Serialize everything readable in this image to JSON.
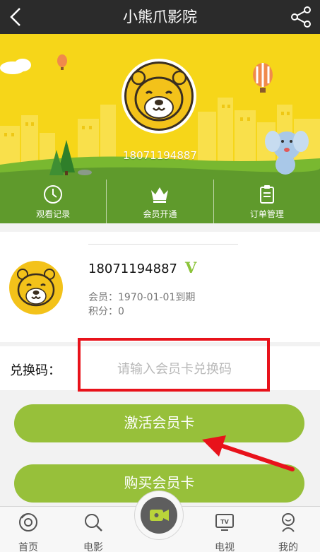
{
  "header": {
    "title": "小熊爪影院",
    "back_icon": "back-chevron-icon",
    "share_icon": "share-icon"
  },
  "banner": {
    "phone": "18071194887",
    "background_color": "#f6d619"
  },
  "actions": [
    {
      "label": "观看记录",
      "icon": "clock-icon"
    },
    {
      "label": "会员开通",
      "icon": "crown-icon"
    },
    {
      "label": "订单管理",
      "icon": "clipboard-icon"
    }
  ],
  "member": {
    "phone": "18071194887",
    "vip_badge": "V",
    "expiry": "会员：1970-01-01到期",
    "points": "积分：0"
  },
  "redeem": {
    "label": "兑换码：",
    "placeholder": "请输入会员卡兑换码",
    "value": ""
  },
  "buttons": {
    "activate": "激活会员卡",
    "buy": "购买会员卡"
  },
  "bottom_nav": [
    {
      "label": "首页",
      "icon": "home-icon"
    },
    {
      "label": "电影",
      "icon": "search-icon"
    },
    {
      "label": "",
      "icon": "video-camera-icon"
    },
    {
      "label": "电视",
      "icon": "tv-icon"
    },
    {
      "label": "我的",
      "icon": "profile-icon"
    }
  ],
  "colors": {
    "accent_green": "#97c03a",
    "action_bar_green": "#5f9a2c",
    "highlight_red": "#e8121b",
    "header_dark": "#2b2b2b"
  }
}
